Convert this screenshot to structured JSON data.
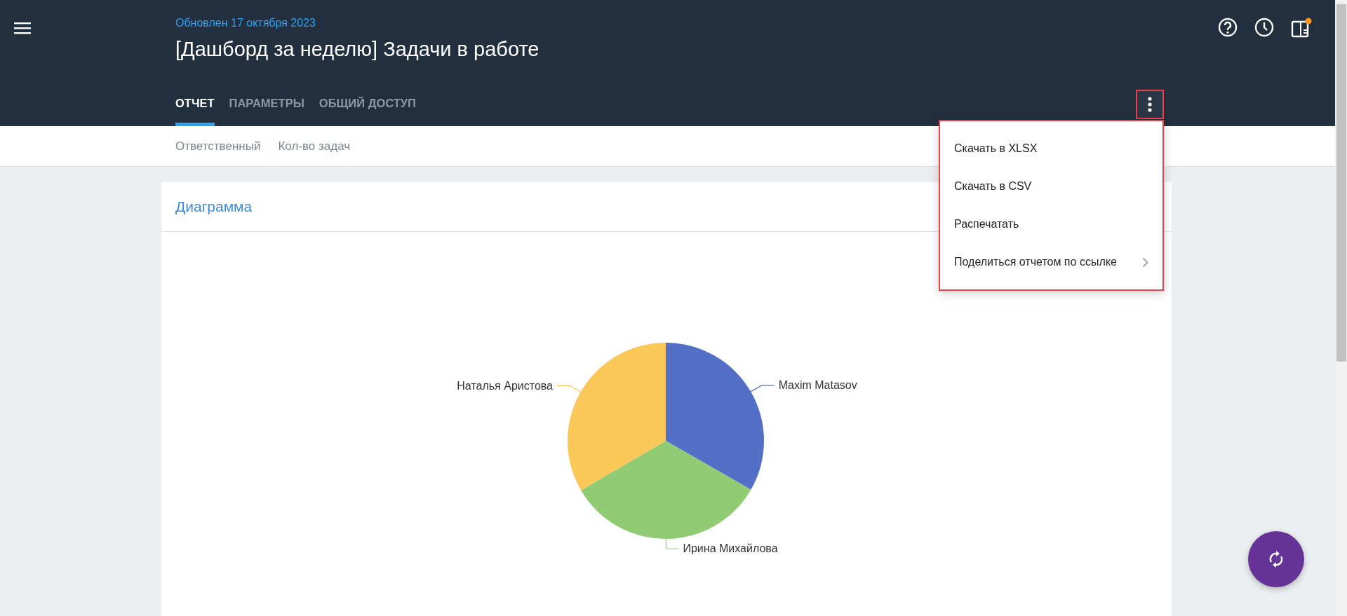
{
  "header": {
    "updated": "Обновлен 17 октября 2023",
    "title": "[Дашборд за неделю] Задачи в работе",
    "notification_dot": true
  },
  "tabs": [
    {
      "label": "ОТЧЕТ",
      "selected": true
    },
    {
      "label": "ПАРАМЕТРЫ",
      "selected": false
    },
    {
      "label": "ОБЩИЙ ДОСТУП",
      "selected": false
    }
  ],
  "columns": [
    "Ответственный",
    "Кол-во задач"
  ],
  "menu": {
    "items": [
      {
        "label": "Скачать в XLSX",
        "has_submenu": false
      },
      {
        "label": "Скачать в CSV",
        "has_submenu": false
      },
      {
        "label": "Распечатать",
        "has_submenu": false
      },
      {
        "label": "Поделиться отчетом по ссылке",
        "has_submenu": true
      }
    ]
  },
  "card": {
    "title": "Диаграмма",
    "chart_data": {
      "type": "pie",
      "categories": [
        "Maxim Matasov",
        "Ирина Михайлова",
        "Наталья Аристова"
      ],
      "values": [
        33.3,
        33.3,
        33.4
      ]
    }
  }
}
